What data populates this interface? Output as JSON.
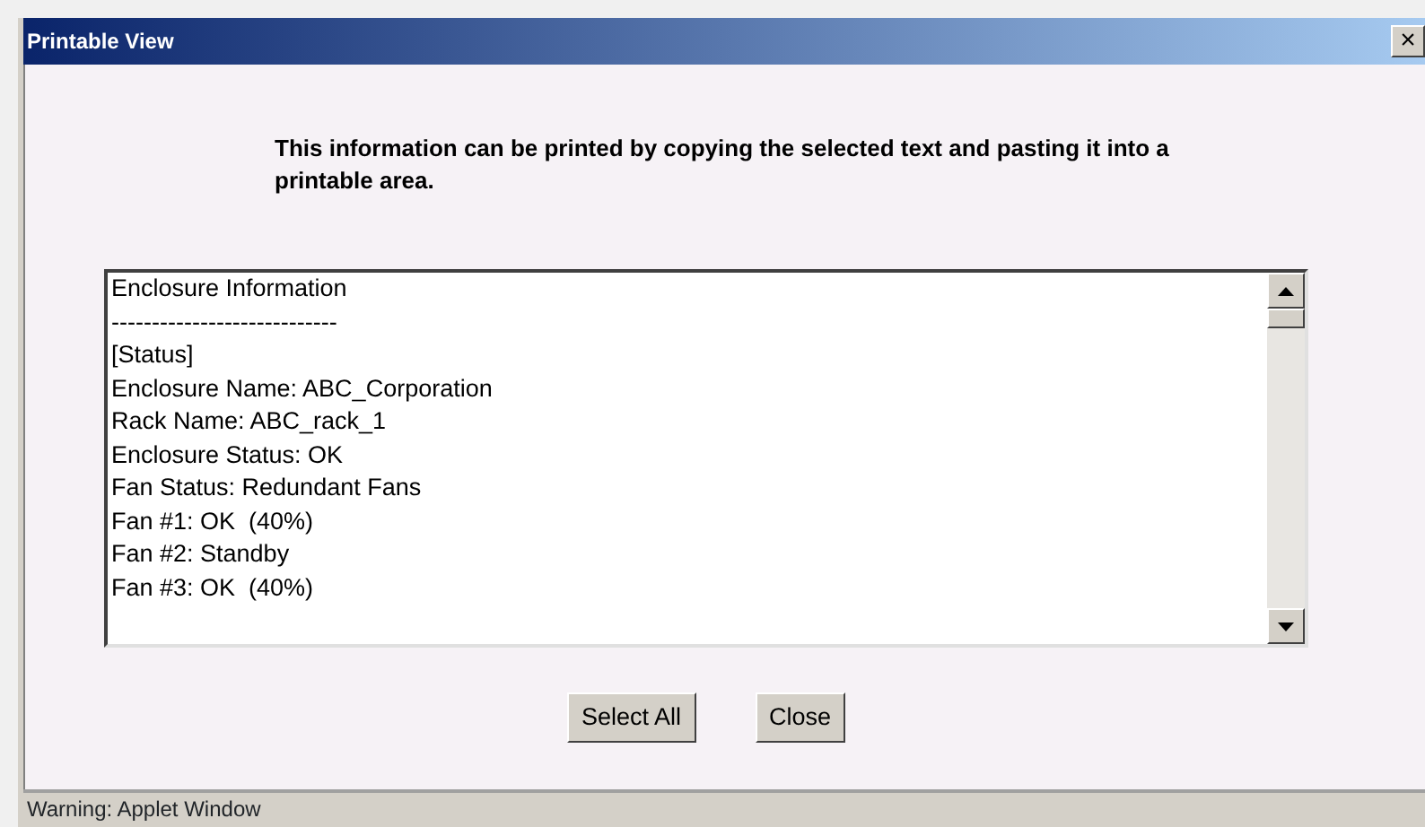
{
  "window": {
    "title": "Printable View",
    "close": "×"
  },
  "message": "This information can be printed by copying the selected text and pasting it into a printable area.",
  "text_area": {
    "lines": [
      "Enclosure Information",
      "----------------------------",
      "[Status]",
      "Enclosure Name: ABC_Corporation",
      "Rack Name: ABC_rack_1",
      "Enclosure Status: OK",
      "Fan Status: Redundant Fans",
      "Fan #1: OK  (40%)",
      "Fan #2: Standby",
      "Fan #3: OK  (40%)"
    ]
  },
  "buttons": [
    "Select All",
    "Close"
  ],
  "status_bar": "Warning: Applet Window"
}
